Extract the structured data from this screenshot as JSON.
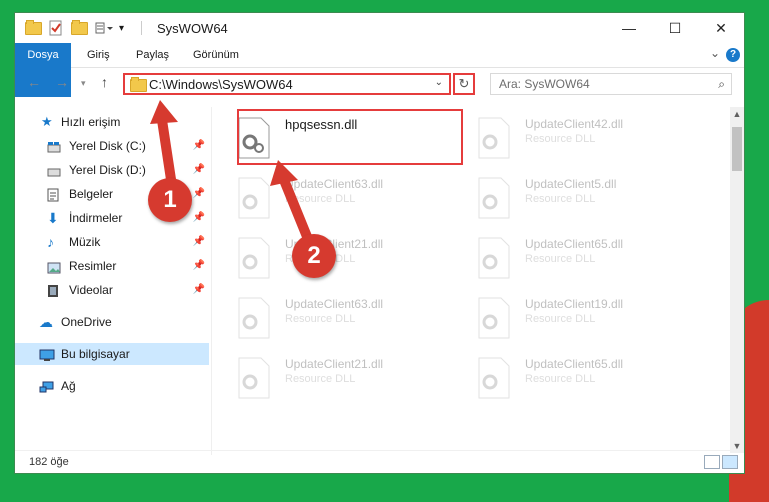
{
  "window": {
    "title": "SysWOW64",
    "controls": {
      "minimize": "—",
      "maximize": "☐",
      "close": "✕"
    }
  },
  "ribbon": {
    "tabs": [
      "Dosya",
      "Giriş",
      "Paylaş",
      "Görünüm"
    ],
    "help": "?"
  },
  "address": {
    "path": "C:\\Windows\\SysWOW64",
    "search_placeholder": "Ara: SysWOW64"
  },
  "sidebar": {
    "quick_access": "Hızlı erişim",
    "items": [
      {
        "label": "Yerel Disk (C:)",
        "icon": "drive-icon",
        "pinned": true
      },
      {
        "label": "Yerel Disk (D:)",
        "icon": "drive-icon",
        "pinned": true
      },
      {
        "label": "Belgeler",
        "icon": "documents-icon",
        "pinned": true
      },
      {
        "label": "İndirmeler",
        "icon": "download-icon",
        "pinned": true
      },
      {
        "label": "Müzik",
        "icon": "music-icon",
        "pinned": true
      },
      {
        "label": "Resimler",
        "icon": "pictures-icon",
        "pinned": true
      },
      {
        "label": "Videolar",
        "icon": "video-icon",
        "pinned": true
      }
    ],
    "onedrive": "OneDrive",
    "this_pc": "Bu bilgisayar",
    "network": "Ağ"
  },
  "files": {
    "highlighted": {
      "name": "hpqsessn.dll",
      "type": ""
    },
    "items": [
      {
        "name": "UpdateClient42.dll",
        "type": "Resource DLL"
      },
      {
        "name": "UpdateClient63.dll",
        "type": "Resource DLL"
      },
      {
        "name": "UpdateClient5.dll",
        "type": "Resource DLL"
      },
      {
        "name": "UpdateClient21.dll",
        "type": "Resource DLL"
      },
      {
        "name": "UpdateClient65.dll",
        "type": "Resource DLL"
      },
      {
        "name": "UpdateClient63.dll",
        "type": "Resource DLL"
      },
      {
        "name": "UpdateClient19.dll",
        "type": "Resource DLL"
      },
      {
        "name": "UpdateClient21.dll",
        "type": "Resource DLL"
      },
      {
        "name": "UpdateClient65.dll",
        "type": "Resource DLL"
      }
    ]
  },
  "status": {
    "count": "182 öğe"
  },
  "annotations": {
    "step1": "1",
    "step2": "2"
  },
  "colors": {
    "accent": "#1979ca",
    "highlight": "#e53c3c",
    "badge": "#d63a2f"
  }
}
